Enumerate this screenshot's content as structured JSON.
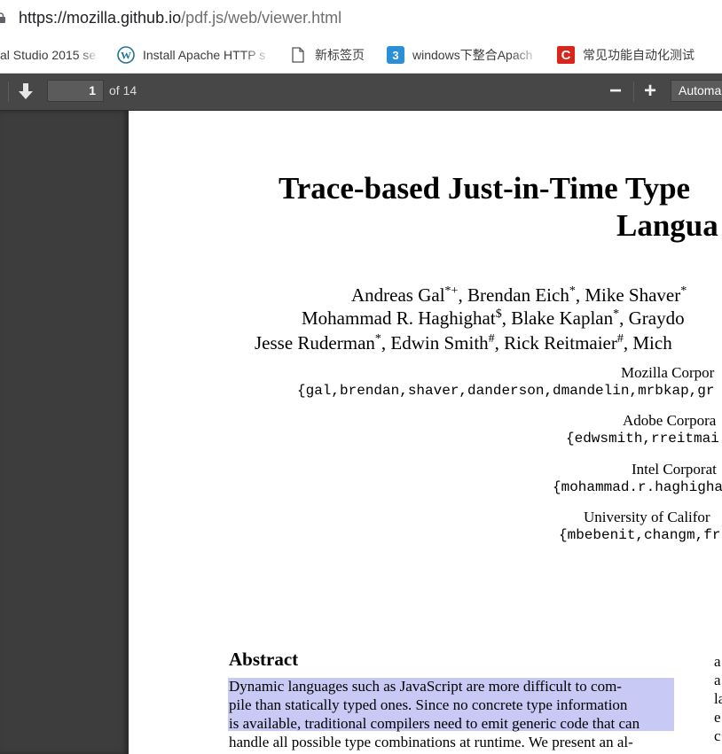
{
  "browser": {
    "url_host": "https://mozilla.github.io",
    "url_path": "/pdf.js/web/viewer.html"
  },
  "bookmarks": [
    {
      "label": "al Studio 2015 se",
      "icon": "none"
    },
    {
      "label": "Install Apache HTTP s",
      "icon": "wordpress-icon"
    },
    {
      "label": "新标签页",
      "icon": "page-icon"
    },
    {
      "label": "windows下整合Apach",
      "icon": "blue-app-icon"
    },
    {
      "label": "常见功能自动化测试",
      "icon": "red-c-icon"
    }
  ],
  "toolbar": {
    "page_number": "1",
    "page_count": "of 14",
    "zoom_out": "−",
    "zoom_in": "+",
    "zoom_select": "Automa"
  },
  "document": {
    "title_line1": "Trace-based Just-in-Time Type",
    "title_line2": "Langua",
    "authors_line1": "Andreas Gal*+, Brendan Eich*, Mike Shaver*",
    "authors_line2": "Mohammad R. Haghighat$, Blake Kaplan*, Graydo",
    "authors_line3": "Jesse Ruderman*, Edwin Smith#, Rick Reitmaier#, Mich",
    "affiliations": [
      {
        "name": "Mozilla Corpor",
        "email": "{gal,brendan,shaver,danderson,dmandelin,mrbkap,gr"
      },
      {
        "name": "Adobe Corpora",
        "email": "{edwsmith,rreitmai"
      },
      {
        "name": "Intel Corporat",
        "email": "{mohammad.r.haghigha"
      },
      {
        "name": "University of Califor",
        "email": "{mbebenit,changm,fr"
      }
    ],
    "abstract_heading": "Abstract",
    "abstract_lines": [
      "Dynamic languages such as JavaScript are more difficult to com-",
      "pile than statically typed ones. Since no concrete type information",
      "is available, traditional compilers need to emit generic code that can",
      "handle all possible type combinations at runtime. We present an al-"
    ],
    "right_column_letters": [
      "a",
      "a",
      "la",
      "e",
      "c"
    ]
  }
}
